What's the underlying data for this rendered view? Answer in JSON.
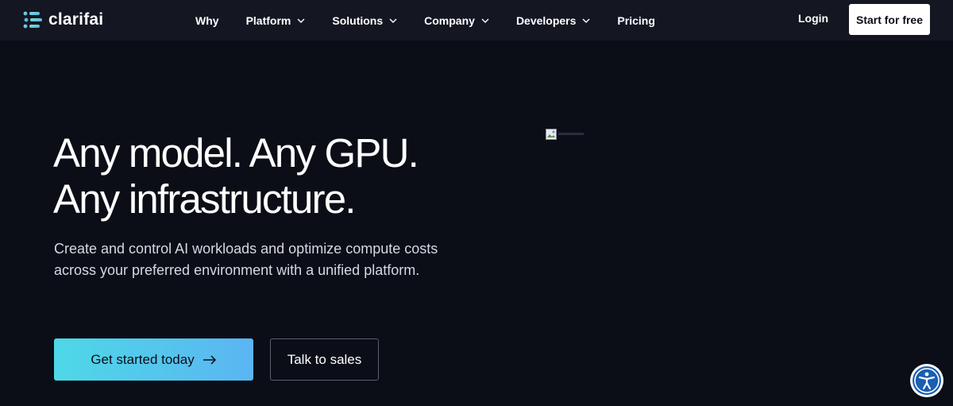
{
  "brand": {
    "name": "clarifai",
    "logo_icon": "clarifai-logo-icon",
    "accent_gradient": [
      "#4ed8e6",
      "#5bb5f2"
    ]
  },
  "nav": {
    "items": [
      {
        "label": "Why",
        "has_dropdown": false
      },
      {
        "label": "Platform",
        "has_dropdown": true
      },
      {
        "label": "Solutions",
        "has_dropdown": true
      },
      {
        "label": "Company",
        "has_dropdown": true
      },
      {
        "label": "Developers",
        "has_dropdown": true
      },
      {
        "label": "Pricing",
        "has_dropdown": false
      }
    ],
    "login_label": "Login",
    "start_label": "Start for free"
  },
  "hero": {
    "headline_line1": "Any model. Any GPU.",
    "headline_line2": "Any infrastructure.",
    "subtext_line1": "Create and control AI workloads and optimize compute costs",
    "subtext_line2": "across your preferred environment with a unified platform.",
    "primary_cta": "Get started today",
    "primary_cta_icon": "arrow-right-icon",
    "secondary_cta": "Talk to sales",
    "hero_image_icon": "broken-image-icon"
  },
  "accessibility": {
    "icon": "accessibility-icon"
  },
  "colors": {
    "background": "#0b0e17",
    "header": "#141722",
    "text": "#ffffff"
  }
}
